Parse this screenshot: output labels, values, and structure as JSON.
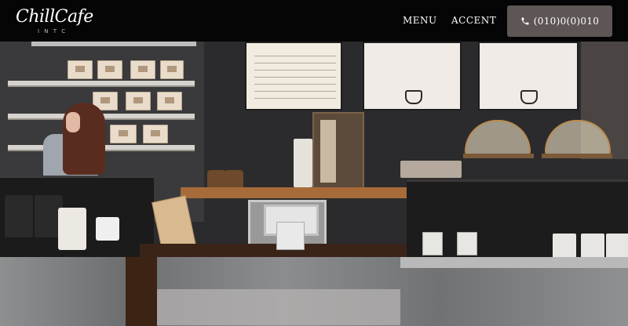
{
  "nav": {
    "logo_text": "ChillCafe",
    "logo_sub": "I N T C",
    "links": [
      "MENU",
      "ACCENT"
    ],
    "phone_label": "(010)0(0)010",
    "colors": {
      "nav_bg": "#050505",
      "phone_button_bg": "#5e5555",
      "text": "#ffffff"
    },
    "icons": {
      "phone": "phone-icon"
    }
  },
  "hero": {
    "description_image": "coffee-shop-interior"
  }
}
